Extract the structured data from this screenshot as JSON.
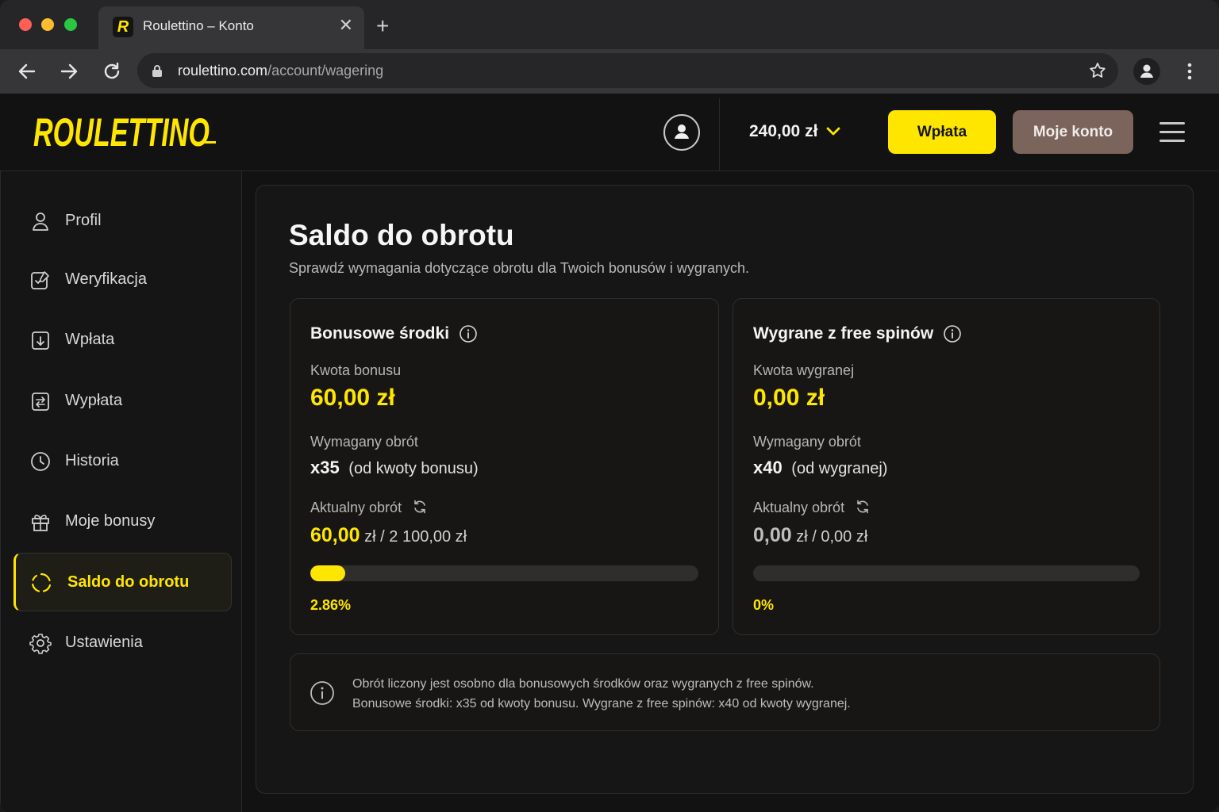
{
  "browser": {
    "tab_title": "Roulettino – Konto",
    "tab_favicon_letter": "R",
    "url_host": "roulettino.com",
    "url_path": "/account/wagering"
  },
  "header": {
    "logo_text": "ROULETTINO",
    "balance": "240,00 zł",
    "deposit_label": "Wpłata",
    "account_label": "Moje konto"
  },
  "sidebar": {
    "items": [
      {
        "label": "Profil",
        "icon": "user-icon"
      },
      {
        "label": "Weryfikacja",
        "icon": "verify-icon"
      },
      {
        "label": "Wpłata",
        "icon": "deposit-icon"
      },
      {
        "label": "Wypłata",
        "icon": "withdraw-icon"
      },
      {
        "label": "Historia",
        "icon": "clock-icon"
      },
      {
        "label": "Moje bonusy",
        "icon": "gift-icon"
      },
      {
        "label": "Saldo do obrotu",
        "icon": "wagering-icon",
        "active": true
      },
      {
        "label": "Ustawienia",
        "icon": "gear-icon"
      }
    ]
  },
  "main": {
    "title": "Saldo do obrotu",
    "subtitle": "Sprawdź wymagania dotyczące obrotu dla Twoich bonusów i wygranych.",
    "cards": [
      {
        "title": "Bonusowe środki",
        "amount_label": "Kwota bonusu",
        "amount": "60,00 zł",
        "required_label": "Wymagany obrót",
        "multiplier": "x35",
        "multiplier_note": "(od kwoty bonusu)",
        "current_label": "Aktualny obrót",
        "current_value": "60,00",
        "current_unit": "zł",
        "separator": "/",
        "target": "2 100,00 zł",
        "progress_fraction": 0.0286,
        "progress_label": "2.86%"
      },
      {
        "title": "Wygrane z free spinów",
        "amount_label": "Kwota wygranej",
        "amount": "0,00 zł",
        "required_label": "Wymagany obrót",
        "multiplier": "x40",
        "multiplier_note": "(od wygranej)",
        "current_label": "Aktualny obrót",
        "current_value": "0,00",
        "current_unit": "zł",
        "separator": "/",
        "target": "0,00 zł",
        "progress_fraction": 0,
        "progress_label": "0%"
      }
    ],
    "note_line1": "Obrót liczony jest osobno dla bonusowych środków oraz wygranych z free spinów.",
    "note_line2": "Bonusowe środki: x35 od kwoty bonusu. Wygrane z free spinów: x40 od kwoty wygranej."
  },
  "colors": {
    "accent": "#ffe600",
    "account_button": "#7a645b",
    "background": "#121212"
  }
}
